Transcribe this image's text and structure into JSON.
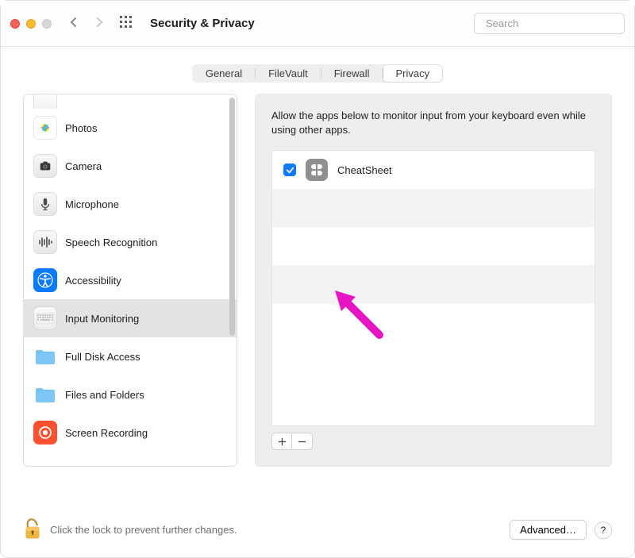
{
  "window": {
    "title": "Security & Privacy"
  },
  "search": {
    "placeholder": "Search"
  },
  "tabs": {
    "items": [
      {
        "label": "General"
      },
      {
        "label": "FileVault"
      },
      {
        "label": "Firewall"
      },
      {
        "label": "Privacy"
      }
    ],
    "active_index": 3
  },
  "sidebar": {
    "items": [
      {
        "label": "Photos"
      },
      {
        "label": "Camera"
      },
      {
        "label": "Microphone"
      },
      {
        "label": "Speech Recognition"
      },
      {
        "label": "Accessibility"
      },
      {
        "label": "Input Monitoring"
      },
      {
        "label": "Full Disk Access"
      },
      {
        "label": "Files and Folders"
      },
      {
        "label": "Screen Recording"
      }
    ],
    "selected_index": 5
  },
  "pane": {
    "description": "Allow the apps below to monitor input from your keyboard even while using other apps.",
    "apps": [
      {
        "checked": true,
        "name": "CheatSheet"
      }
    ]
  },
  "footer": {
    "lock_text": "Click the lock to prevent further changes.",
    "advanced_label": "Advanced…",
    "help_label": "?"
  }
}
